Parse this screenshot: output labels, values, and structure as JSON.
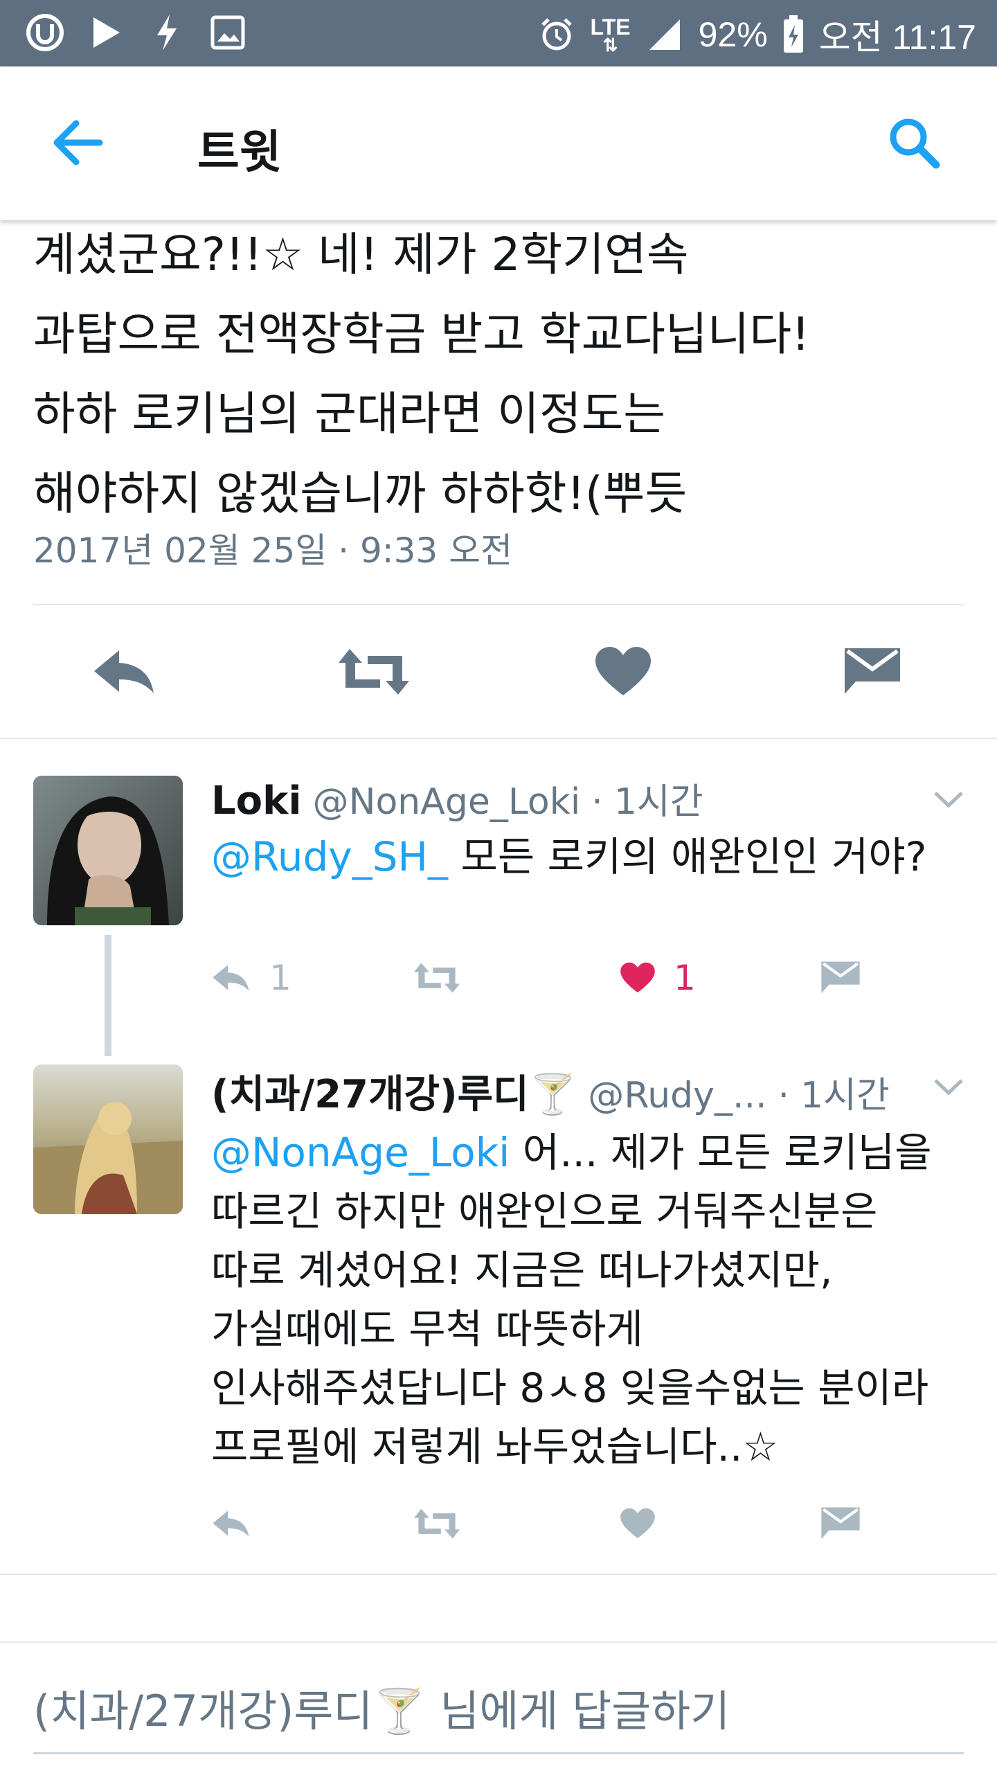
{
  "status_bar": {
    "signal_label": "LTE",
    "battery": "92%",
    "time": "오전 11:17",
    "icons": [
      "u-plus-icon",
      "play-icon",
      "flash-icon",
      "image-icon",
      "alarm-icon",
      "lte-icon",
      "signal-icon",
      "battery-icon"
    ]
  },
  "header": {
    "title": "트윗",
    "back_icon": "arrow-left-icon",
    "search_icon": "search-icon"
  },
  "main_tweet": {
    "lines": [
      "계셨군요?!!☆ 네! 제가 2학기연속",
      "과탑으로 전액장학금 받고 학교다닙니다!",
      "하하 로키님의 군대라면 이정도는",
      "해야하지 않겠습니까 하하핫!(뿌듯"
    ],
    "date": "2017년 02월 25일 · 9:33 오전"
  },
  "replies": [
    {
      "name": "Loki",
      "handle": "@NonAge_Loki",
      "separator": "·",
      "time": "1시간",
      "mention": "@Rudy_SH_",
      "lines_first": " 모든 로키의 애완인인 거야?",
      "lines": [],
      "reply_count": "1",
      "retweet_count": "",
      "like_count": "1",
      "liked": true
    },
    {
      "name": "(치과/27개강)루디🍸",
      "handle": "@Rudy_...",
      "separator": "·",
      "time": "1시간",
      "mention": "@NonAge_Loki",
      "lines_first": " 어... 제가 모든 로키님을",
      "lines": [
        "따르긴 하지만 애완인으로 거둬주신분은",
        "따로 계셨어요! 지금은 떠나가셨지만,",
        "가실때에도 무척 따뜻하게",
        "인사해주셨답니다 8ㅅ8 잊을수없는 분이라",
        "프로필에 저렇게 놔두었습니다..☆"
      ],
      "reply_count": "",
      "retweet_count": "",
      "like_count": "",
      "liked": false
    }
  ],
  "compose": {
    "placeholder": "(치과/27개강)루디🍸 님에게 답글하기"
  },
  "colors": {
    "accent": "#1da1f2",
    "status_bar": "#5f6f82",
    "like": "#e0245e",
    "muted": "#657786",
    "action_icon": "#aab8c2",
    "main_action_icon": "#657786"
  }
}
